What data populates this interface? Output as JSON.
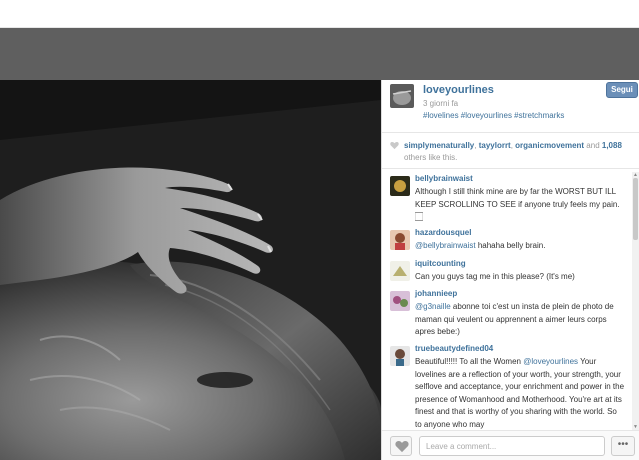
{
  "post": {
    "username": "loveyourlines",
    "time": "3 giorni fa",
    "tags": "#lovelines #loveyourlines #stretchmarks",
    "follow_label": "Segui"
  },
  "likes": {
    "likers": [
      "simplymenaturally",
      "tayylorrt",
      "organicmovement"
    ],
    "sep1": ", ",
    "sep2": ", ",
    "and_text": " and ",
    "others_count": "1,088",
    "others_text": " others like this."
  },
  "comments": [
    {
      "username": "bellybrainwaist",
      "text": "Although I still think mine are by far the WORST BUT ILL KEEP SCROLLING TO SEE if anyone truly feels my pain. 🏻"
    },
    {
      "username": "hazardousquel",
      "mention": "@bellybrainwaist",
      "text": " hahaha belly brain."
    },
    {
      "username": "iquitcounting",
      "text": "Can you guys tag me in this please? (It's me)"
    },
    {
      "username": "johannieep",
      "mention": "@g3naille",
      "text": " abonne toi c'est un insta de plein de photo de maman qui veulent ou apprennent a aimer leurs corps apres bebe:)"
    },
    {
      "username": "truebeautydefined04",
      "text_before": "Beautiful!!!!! To all the Women ",
      "mention": "@loveyourlines",
      "text": " Your lovelines are a reflection of your worth, your strength, your selflove and acceptance, your enrichment and power in the presence of Womanhood and Motherhood. You're art at its finest and that is worthy of you sharing with the world. So to anyone who may"
    }
  ],
  "footer": {
    "comment_placeholder": "Leave a comment...",
    "more_label": "•••"
  },
  "icons": {
    "heart": "heart-icon",
    "more": "more-icon"
  },
  "colors": {
    "link": "#3f729b",
    "follow_button": "#6b8fb8"
  }
}
